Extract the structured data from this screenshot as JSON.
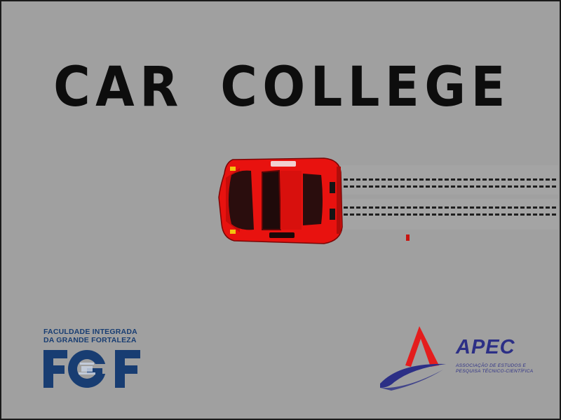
{
  "game": {
    "title": "CAR COLLEGE"
  },
  "colors": {
    "background": "#a0a0a0",
    "car_body": "#e8120f",
    "car_glass": "#2a0d0d",
    "skid_marks": "#1e1e1e",
    "fgf_brand": "#183d72",
    "apec_brand": "#2c2f86",
    "apec_red": "#e41d1d"
  },
  "sprites": {
    "player_car": "red-sports-car-topdown",
    "skid_marks": "tire-skid-marks",
    "debris": "red-debris-dot"
  },
  "logos": {
    "fgf": {
      "line1": "FACULDADE INTEGRADA",
      "line2": "DA GRANDE FORTALEZA",
      "acronym": "FGF"
    },
    "apec": {
      "acronym": "APEC",
      "line1": "ASSOCIAÇÃO DE ESTUDOS E",
      "line2": "PESQUISA TÉCNICO-CIENTÍFICA"
    }
  }
}
